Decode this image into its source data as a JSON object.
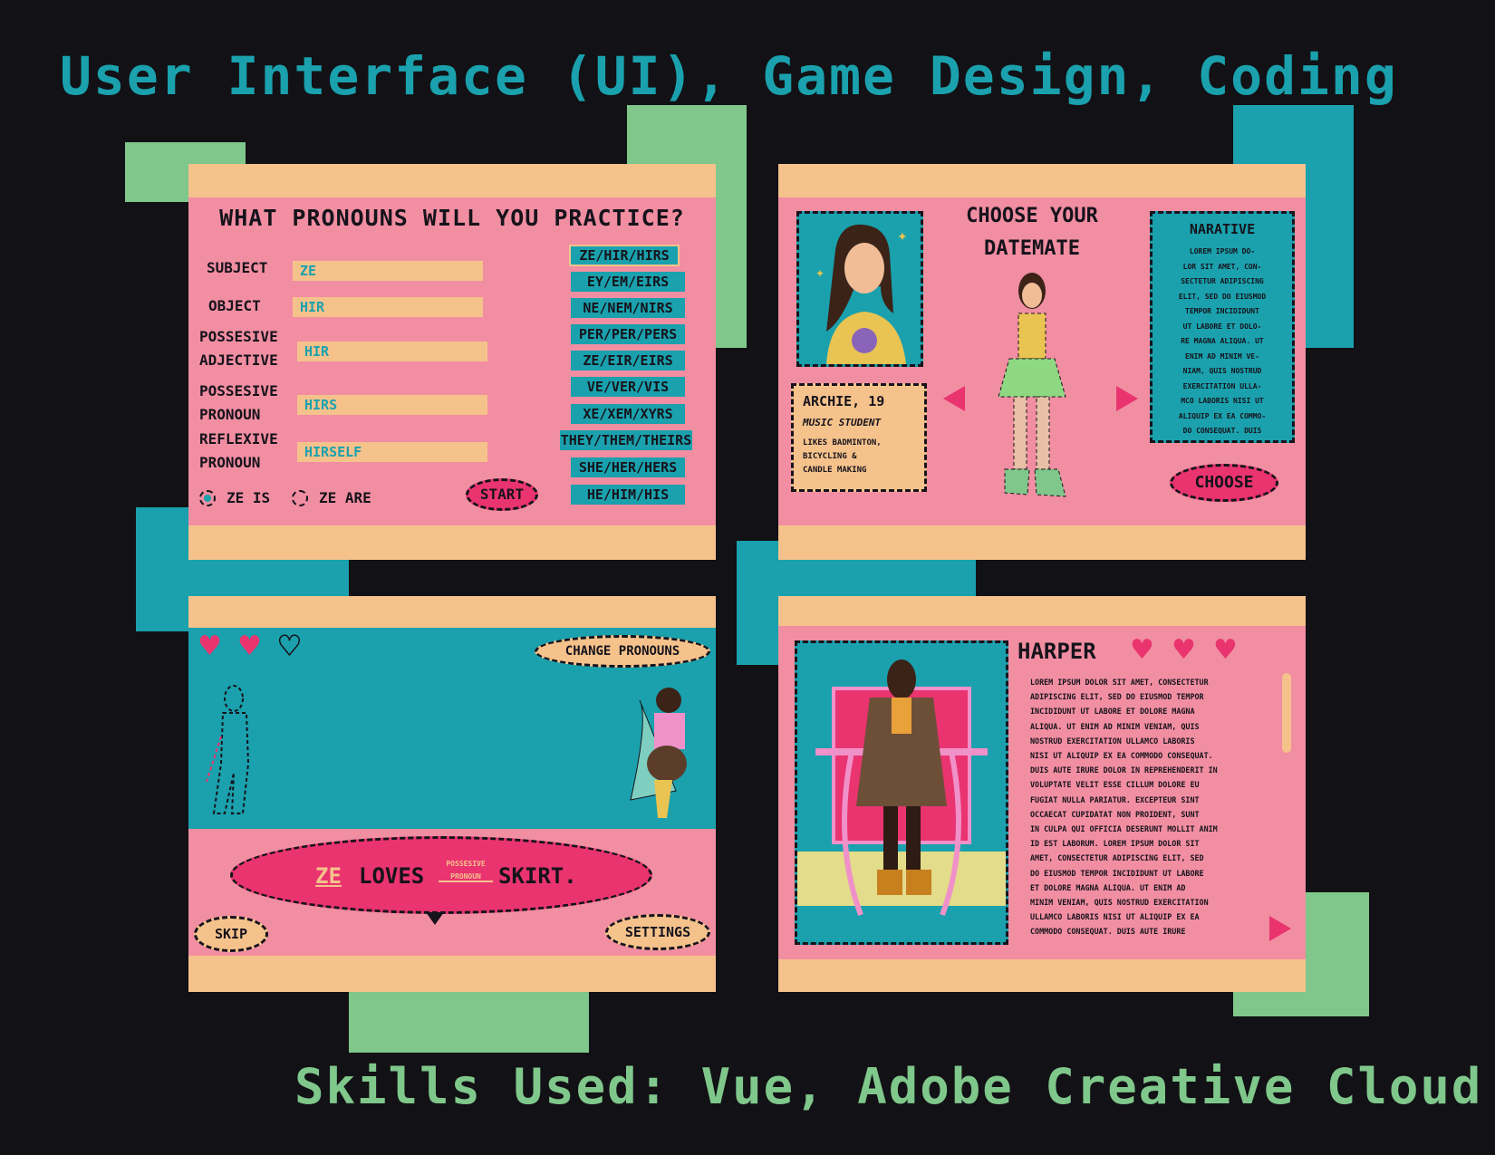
{
  "header": {
    "title": "User Interface (UI), Game Design, Coding"
  },
  "footer": {
    "skills": "Skills Used: Vue, Adobe Creative Cloud"
  },
  "colors": {
    "background": "#121115",
    "teal": "#1aa1ad",
    "green": "#7fc78b",
    "pink": "#f18ea2",
    "peach": "#f5c28c",
    "magenta": "#e9346f"
  },
  "pronoun_screen": {
    "title": "WHAT PRONOUNS WILL YOU PRACTICE?",
    "fields": [
      {
        "label_line1": "SUBJECT",
        "label_line2": "",
        "value": "ZE"
      },
      {
        "label_line1": "OBJECT",
        "label_line2": "",
        "value": "HIR"
      },
      {
        "label_line1": "POSSESIVE",
        "label_line2": "ADJECTIVE",
        "value": "HIR"
      },
      {
        "label_line1": "POSSESIVE",
        "label_line2": "PRONOUN",
        "value": "HIRS"
      },
      {
        "label_line1": "REFLEXIVE",
        "label_line2": "PRONOUN",
        "value": "HIRSELF"
      }
    ],
    "pronoun_sets": [
      "ZE/HIR/HIRS",
      "EY/EM/EIRS",
      "NE/NEM/NIRS",
      "PER/PER/PERS",
      "ZE/EIR/EIRS",
      "VE/VER/VIS",
      "XE/XEM/XYRS",
      "THEY/THEM/THEIRS",
      "SHE/HER/HERS",
      "HE/HIM/HIS"
    ],
    "radio_options": [
      "ZE IS",
      "ZE ARE"
    ],
    "selected_radio": "ZE IS",
    "start_label": "START"
  },
  "datemate_screen": {
    "title_line1": "CHOOSE YOUR",
    "title_line2": "DATEMATE",
    "profile": {
      "name": "ARCHIE, 19",
      "role": "MUSIC STUDENT",
      "likes_line1": "LIKES BADMINTON,",
      "likes_line2": "BICYCLING &",
      "likes_line3": "CANDLE MAKING"
    },
    "narrative": {
      "title": "NARATIVE",
      "lines": [
        "LOREM IPSUM DO-",
        "LOR SIT AMET, CON-",
        "SECTETUR ADIPISCING",
        "ELIT, SED DO EIUSMOD",
        "TEMPOR INCIDIDUNT",
        "UT LABORE ET DOLO-",
        "RE MAGNA ALIQUA. UT",
        "ENIM AD MINIM VE-",
        "NIAM, QUIS NOSTRUD",
        "EXERCITATION ULLA-",
        "MCO LABORIS NISI UT",
        "ALIQUIP EX EA COMMO-",
        "DO CONSEQUAT. DUIS"
      ]
    },
    "choose_label": "CHOOSE",
    "prev_icon": "left-arrow-icon",
    "next_icon": "right-arrow-icon"
  },
  "gameplay_screen": {
    "hearts_filled": 2,
    "hearts_total": 3,
    "change_pronouns_label": "CHANGE PRONOUNS",
    "sentence": {
      "subject": "ZE",
      "verb": "LOVES",
      "blank_hint_line1": "POSSESIVE",
      "blank_hint_line2": "PRONOUN",
      "object": "SKIRT."
    },
    "skip_label": "SKIP",
    "settings_label": "SETTINGS"
  },
  "profile_screen": {
    "name": "HARPER",
    "hearts": 3,
    "lines": [
      "LOREM IPSUM DOLOR SIT AMET, CONSECTETUR",
      "ADIPISCING ELIT, SED DO EIUSMOD TEMPOR",
      "INCIDIDUNT UT LABORE ET DOLORE MAGNA",
      "ALIQUA. UT ENIM AD MINIM VENIAM, QUIS",
      "NOSTRUD EXERCITATION ULLAMCO LABORIS",
      "NISI UT ALIQUIP EX EA COMMODO CONSEQUAT.",
      "DUIS AUTE IRURE DOLOR IN REPREHENDERIT IN",
      "VOLUPTATE VELIT ESSE CILLUM DOLORE EU",
      "FUGIAT NULLA PARIATUR. EXCEPTEUR SINT",
      "OCCAECAT CUPIDATAT NON PROIDENT, SUNT",
      "IN CULPA QUI OFFICIA DESERUNT MOLLIT ANIM",
      "ID EST LABORUM.   LOREM IPSUM DOLOR SIT",
      "AMET, CONSECTETUR ADIPISCING ELIT, SED",
      "DO EIUSMOD TEMPOR INCIDIDUNT UT LABORE",
      "ET DOLORE MAGNA ALIQUA. UT ENIM AD",
      "MINIM VENIAM, QUIS NOSTRUD EXERCITATION",
      "ULLAMCO LABORIS NISI UT ALIQUIP EX EA",
      "COMMODO CONSEQUAT. DUIS AUTE IRURE"
    ],
    "next_icon": "right-arrow-icon"
  }
}
